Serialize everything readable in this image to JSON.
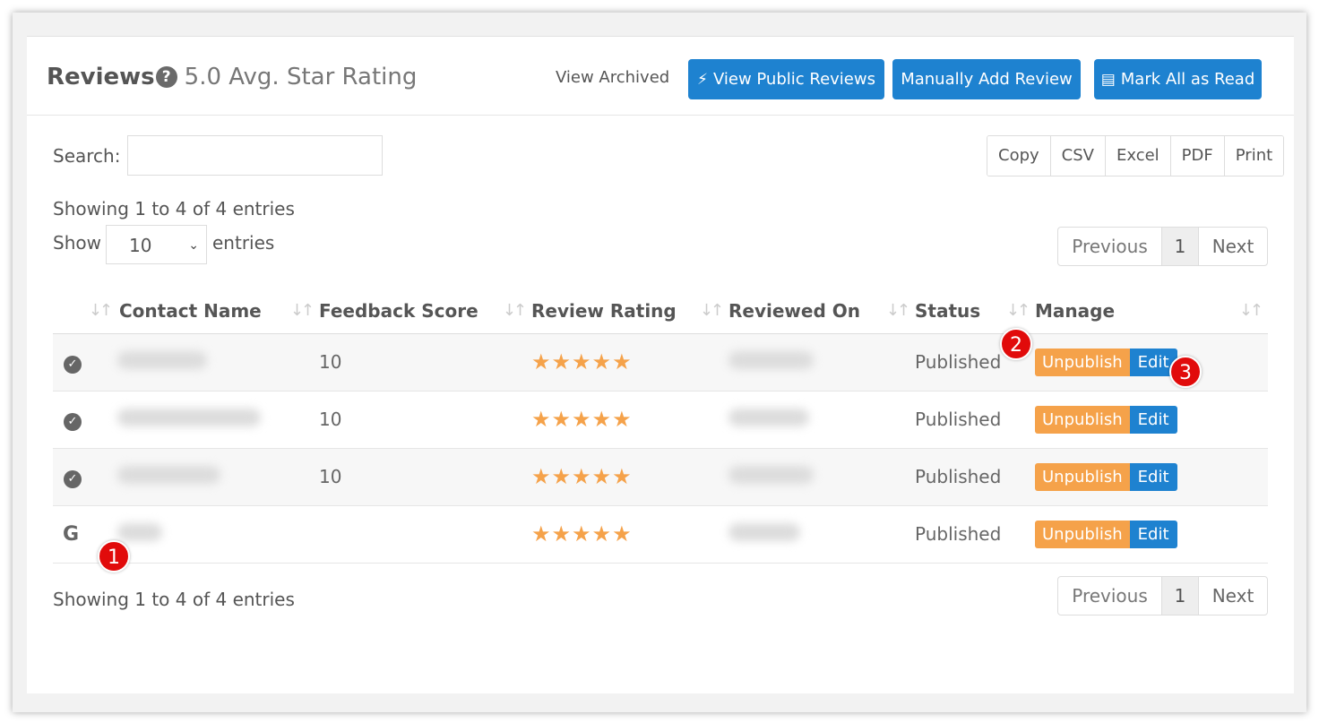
{
  "header": {
    "title": "Reviews",
    "help_icon": "question-circle-icon",
    "avg_rating": "5.0 Avg. Star Rating",
    "view_archived": "View Archived",
    "buttons": {
      "view_public": "View Public Reviews",
      "manually_add": "Manually Add Review",
      "mark_all_read": "Mark All as Read"
    }
  },
  "search": {
    "label": "Search:",
    "value": "",
    "placeholder": ""
  },
  "export": [
    "Copy",
    "CSV",
    "Excel",
    "PDF",
    "Print"
  ],
  "info_top": "Showing 1 to 4 of 4 entries",
  "info_bottom": "Showing 1 to 4 of 4 entries",
  "length": {
    "show": "Show",
    "value": "10",
    "entries": "entries"
  },
  "pagination": {
    "previous": "Previous",
    "page": "1",
    "next": "Next"
  },
  "table": {
    "columns": [
      "",
      "Contact Name",
      "Feedback Score",
      "Review Rating",
      "Reviewed On",
      "Status",
      "Manage"
    ],
    "rows": [
      {
        "source_icon": "check-circle-icon",
        "feedback_score": "10",
        "stars": "★★★★★",
        "status": "Published",
        "unpublish": "Unpublish",
        "edit": "Edit"
      },
      {
        "source_icon": "check-circle-icon",
        "feedback_score": "10",
        "stars": "★★★★★",
        "status": "Published",
        "unpublish": "Unpublish",
        "edit": "Edit"
      },
      {
        "source_icon": "check-circle-icon",
        "feedback_score": "10",
        "stars": "★★★★★",
        "status": "Published",
        "unpublish": "Unpublish",
        "edit": "Edit"
      },
      {
        "source_icon": "google-icon",
        "feedback_score": "",
        "stars": "★★★★★",
        "status": "Published",
        "unpublish": "Unpublish",
        "edit": "Edit"
      }
    ]
  },
  "annotations": [
    "1",
    "2",
    "3"
  ],
  "colors": {
    "primary": "#1e82d0",
    "warning": "#f5a24a",
    "marker": "#e10b0b"
  }
}
